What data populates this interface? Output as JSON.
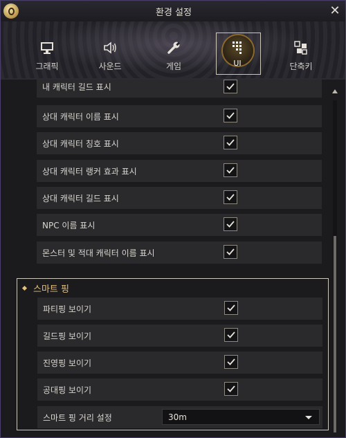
{
  "window": {
    "title": "환경 설정",
    "close_glyph": "✕",
    "logo_icon": "app-logo-icon"
  },
  "tabs": [
    {
      "label": "그래픽",
      "icon": "monitor-icon",
      "active": false
    },
    {
      "label": "사운드",
      "icon": "speaker-icon",
      "active": false
    },
    {
      "label": "게임",
      "icon": "wrench-icon",
      "active": false
    },
    {
      "label": "UI",
      "icon": "ui-grid-icon",
      "active": true
    },
    {
      "label": "단축키",
      "icon": "shortcut-keys-icon",
      "active": false
    }
  ],
  "settings": [
    {
      "label": "내 캐릭터 길드 표시",
      "checked": true
    },
    {
      "label": "상대 캐릭터 이름 표시",
      "checked": true
    },
    {
      "label": "상대 캐릭터 칭호 표시",
      "checked": true
    },
    {
      "label": "상대 캐릭터 랭커 효과 표시",
      "checked": true
    },
    {
      "label": "상대 캐릭터 길드 표시",
      "checked": true
    },
    {
      "label": "NPC 이름 표시",
      "checked": true
    },
    {
      "label": "몬스터 및 적대 캐릭터 이름 표시",
      "checked": true
    }
  ],
  "smart_ping": {
    "title": "스마트 핑",
    "items": [
      {
        "label": "파티핑 보이기",
        "checked": true
      },
      {
        "label": "길드핑 보이기",
        "checked": true
      },
      {
        "label": "진영핑 보이기",
        "checked": true
      },
      {
        "label": "공대핑 보이기",
        "checked": true
      }
    ],
    "distance": {
      "label": "스마트 핑 거리 설정",
      "value": "30m"
    }
  },
  "colors": {
    "accent": "#e3c17e",
    "row_bg": "#2a292c",
    "window_border": "#4a3e6a"
  }
}
